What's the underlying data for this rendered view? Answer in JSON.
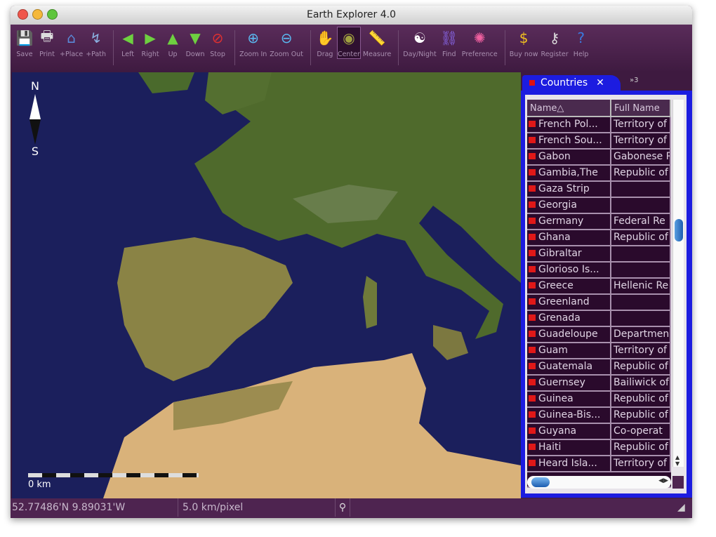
{
  "window": {
    "title": "Earth Explorer 4.0"
  },
  "toolbar": [
    {
      "id": "save",
      "label": "Save",
      "icon": "floppy-icon",
      "glyph": "💾"
    },
    {
      "id": "print",
      "label": "Print",
      "icon": "printer-icon",
      "glyph": "🖶"
    },
    {
      "id": "place",
      "label": "+Place",
      "icon": "home-icon",
      "glyph": "⌂"
    },
    {
      "id": "path",
      "label": "+Path",
      "icon": "path-icon",
      "glyph": "↯"
    },
    {
      "id": "left",
      "label": "Left",
      "icon": "arrow-left-icon",
      "glyph": "◀"
    },
    {
      "id": "right",
      "label": "Right",
      "icon": "arrow-right-icon",
      "glyph": "▶"
    },
    {
      "id": "up",
      "label": "Up",
      "icon": "arrow-up-icon",
      "glyph": "▲"
    },
    {
      "id": "down",
      "label": "Down",
      "icon": "arrow-down-icon",
      "glyph": "▼"
    },
    {
      "id": "stop",
      "label": "Stop",
      "icon": "stop-icon",
      "glyph": "⊘"
    },
    {
      "id": "zoomin",
      "label": "Zoom In",
      "icon": "zoom-in-icon",
      "glyph": "⊕"
    },
    {
      "id": "zoomout",
      "label": "Zoom Out",
      "icon": "zoom-out-icon",
      "glyph": "⊖"
    },
    {
      "id": "drag",
      "label": "Drag",
      "icon": "hand-icon",
      "glyph": "✋"
    },
    {
      "id": "center",
      "label": "Center",
      "icon": "center-icon",
      "glyph": "◉"
    },
    {
      "id": "measure",
      "label": "Measure",
      "icon": "ruler-icon",
      "glyph": "📏"
    },
    {
      "id": "daynight",
      "label": "Day/Night",
      "icon": "yin-yang-icon",
      "glyph": "☯"
    },
    {
      "id": "find",
      "label": "Find",
      "icon": "binoculars-icon",
      "glyph": "⛓"
    },
    {
      "id": "preference",
      "label": "Preference",
      "icon": "color-wheel-icon",
      "glyph": "✺"
    },
    {
      "id": "buy",
      "label": "Buy now",
      "icon": "money-icon",
      "glyph": "$"
    },
    {
      "id": "register",
      "label": "Register",
      "icon": "key-icon",
      "glyph": "⚷"
    },
    {
      "id": "help",
      "label": "Help",
      "icon": "help-icon",
      "glyph": "?"
    }
  ],
  "map": {
    "north": "N",
    "south": "S",
    "scale_label": "0 km"
  },
  "panel": {
    "tab_label": "Countries",
    "tab2_label": "»3",
    "columns": [
      "Name△",
      "Full Name"
    ],
    "rows": [
      [
        "French Pol...",
        "Territory of"
      ],
      [
        "French Sou...",
        "Territory of"
      ],
      [
        "Gabon",
        "Gabonese R"
      ],
      [
        "Gambia,The",
        "Republic of"
      ],
      [
        "Gaza Strip",
        ""
      ],
      [
        "Georgia",
        ""
      ],
      [
        "Germany",
        "Federal Re"
      ],
      [
        "Ghana",
        "Republic of"
      ],
      [
        "Gibraltar",
        ""
      ],
      [
        "Glorioso Is...",
        ""
      ],
      [
        "Greece",
        "Hellenic Re"
      ],
      [
        "Greenland",
        ""
      ],
      [
        "Grenada",
        ""
      ],
      [
        "Guadeloupe",
        "Departmen"
      ],
      [
        "Guam",
        "Territory of"
      ],
      [
        "Guatemala",
        "Republic of"
      ],
      [
        "Guernsey",
        "Bailiwick of"
      ],
      [
        "Guinea",
        "Republic of"
      ],
      [
        "Guinea-Bis...",
        "Republic of"
      ],
      [
        "Guyana",
        "Co-operat"
      ],
      [
        "Haiti",
        "Republic of"
      ],
      [
        "Heard Isla...",
        "Territory of"
      ]
    ]
  },
  "status": {
    "coords": "52.77486'N  9.89031'W",
    "scale": "5.0 km/pixel"
  }
}
